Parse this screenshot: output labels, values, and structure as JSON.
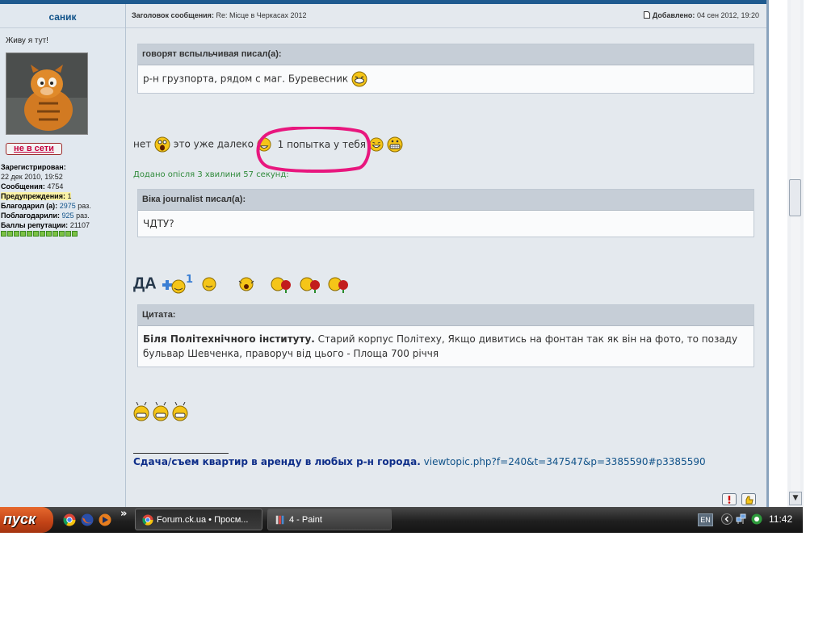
{
  "profile": {
    "username": "саник",
    "status_text": "Живу я тут!",
    "offline_label": "не в сети",
    "stats": [
      {
        "label": "Зарегистрирован:",
        "value": ""
      },
      {
        "label": "",
        "value": "22 дек 2010, 19:52"
      },
      {
        "label": "Сообщения:",
        "value": "4754"
      },
      {
        "label": "Предупреждения:",
        "value": "1"
      },
      {
        "label": "Благодарил (а):",
        "value": "2975",
        "suffix": "раз."
      },
      {
        "label": "Поблагодарили:",
        "value": "925",
        "suffix": "раз."
      },
      {
        "label": "Баллы репутации:",
        "value": "21107"
      }
    ]
  },
  "post": {
    "subject_label": "Заголовок сообщения:",
    "subject": "Re: Місце в Черкасах 2012",
    "added_label": "Добавлено:",
    "added": "04 сен 2012, 19:20",
    "quote1": {
      "header": "говорят вспыльчивая писал(а):",
      "text": "р-н грузпорта, рядом с маг. Буревесник"
    },
    "reply1": {
      "part1": "нет",
      "part2": "это уже далеко",
      "part3": "1 попытка у тебя"
    },
    "late_note": "Додано опісля 3 хвилини 57 секунд:",
    "quote2": {
      "header": "Віка journalist писал(а):",
      "text": "ЧДТУ?"
    },
    "big_text": "ДА",
    "quote3": {
      "header": "Цитата:",
      "bold": "Біля Політехнічного інституту.",
      "text": " Старий корпус Політеху, Якщо дивитись на фонтан так як він на фото, то позаду бульвар Шевченка, праворуч від цього - Площа 700 річчя"
    },
    "signature": {
      "bold": "Сдача/съем квартир в аренду в любых р-н города.",
      "link": "viewtopic.php?f=240&t=347547&p=3385590#p3385590"
    }
  },
  "taskbar": {
    "start_label": "пуск",
    "overflow": "»",
    "task1_label": "Forum.ck.ua • Просм...",
    "task2_label": "4 - Paint",
    "lang": "EN",
    "clock": "11:42"
  }
}
